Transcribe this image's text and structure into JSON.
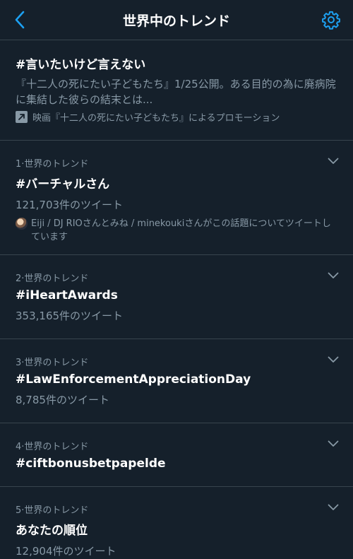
{
  "header": {
    "title": "世界中のトレンド"
  },
  "promo": {
    "hashtag": "#言いたいけど言えない",
    "description": "『十二人の死にたい子どもたち』1/25公開。ある目的の為に廃病院に集結した彼らの結末とは...",
    "promoted_by": "映画『十二人の死にたい子どもたち』によるプロモーション"
  },
  "trends": [
    {
      "meta": "1·世界のトレンド",
      "name": "#バーチャルさん",
      "count": "121,703件のツイート",
      "context": "Eiji / DJ RIOさんとみね / minekoukiさんがこの話題についてツイートしています"
    },
    {
      "meta": "2·世界のトレンド",
      "name": "#iHeartAwards",
      "count": "353,165件のツイート"
    },
    {
      "meta": "3·世界のトレンド",
      "name": "#LawEnforcementAppreciationDay",
      "count": "8,785件のツイート"
    },
    {
      "meta": "4·世界のトレンド",
      "name": "#ciftbonusbetpapelde"
    },
    {
      "meta": "5·世界のトレンド",
      "name": "あなたの順位",
      "count": "12,904件のツイート"
    }
  ],
  "colors": {
    "background": "#15202b",
    "accent": "#1da1f2",
    "muted": "#8899a6",
    "divider": "#38444d"
  },
  "icons": {
    "back": "chevron-left-icon",
    "settings": "gear-icon",
    "promoted": "promoted-arrow-icon",
    "more": "chevron-down-icon"
  }
}
